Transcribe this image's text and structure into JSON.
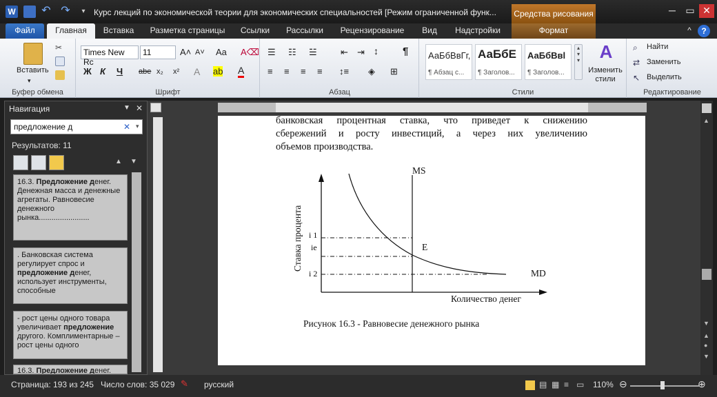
{
  "title_bar": {
    "document_title": "Курс лекций по экономической теории для экономических специальностей [Режим ограниченной функ...",
    "context_group": "Средства рисования"
  },
  "tabs": [
    "Файл",
    "Главная",
    "Вставка",
    "Разметка страницы",
    "Ссылки",
    "Рассылки",
    "Рецензирование",
    "Вид",
    "Надстройки",
    "Формат"
  ],
  "ribbon": {
    "clipboard": {
      "paste_label": "Вставить",
      "group_label": "Буфер обмена"
    },
    "font": {
      "font_name": "Times New Rc",
      "font_size": "11",
      "group_label": "Шрифт",
      "case_label": "Aa",
      "bold": "Ж",
      "italic": "К",
      "underline": "Ч",
      "strike": "abe",
      "sub": "x₂",
      "sup": "x²"
    },
    "paragraph": {
      "group_label": "Абзац"
    },
    "styles": {
      "group_label": "Стили",
      "items": [
        {
          "sample": "АаБбВвГг,",
          "name": "¶ Абзац с..."
        },
        {
          "sample": "АаБбЕ",
          "name": "¶ Заголов..."
        },
        {
          "sample": "АаБбВвl",
          "name": "¶ Заголов..."
        }
      ],
      "change_styles": "Изменить стили"
    },
    "editing": {
      "find": "Найти",
      "replace": "Заменить",
      "select": "Выделить",
      "group_label": "Редактирование"
    }
  },
  "navigation": {
    "title": "Навигация",
    "search_value": "предложение д",
    "results_label": "Результатов: 11",
    "results": [
      {
        "pre": "16.3. ",
        "hit": "Предложение д",
        "post": "енег. Денежная масса и денежные агрегаты. Равновесие денежного рынка........................"
      },
      {
        "pre": ". Банковская система регулирует спрос и ",
        "hit": "предложение д",
        "post": "енег, использует инструменты, способные"
      },
      {
        "pre": "- рост цены одного товара увеличивает ",
        "hit": "предложение",
        "post": " другого. Комплиментарные – рост цены одного"
      },
      {
        "pre": "16.3. ",
        "hit": "Предложение д",
        "post": "енег."
      }
    ]
  },
  "document": {
    "lines": [
      "банковская процентная ставка, что приведет к снижению",
      "сбережений и росту инвестиций, а через них увеличению",
      "объемов производства."
    ],
    "figure": {
      "y_axis_label": "Ставка процента",
      "x_axis_label": "Количество денег",
      "ms_label": "MS",
      "md_label": "MD",
      "e_label": "E",
      "i1_label": "i 1",
      "ie_label": "ie",
      "i2_label": "i 2",
      "caption": "Рисунок 16.3 - Равновесие денежного рынка"
    }
  },
  "status_bar": {
    "page": "Страница: 193 из 245",
    "words": "Число слов: 35 029",
    "language": "русский",
    "zoom": "110%"
  }
}
